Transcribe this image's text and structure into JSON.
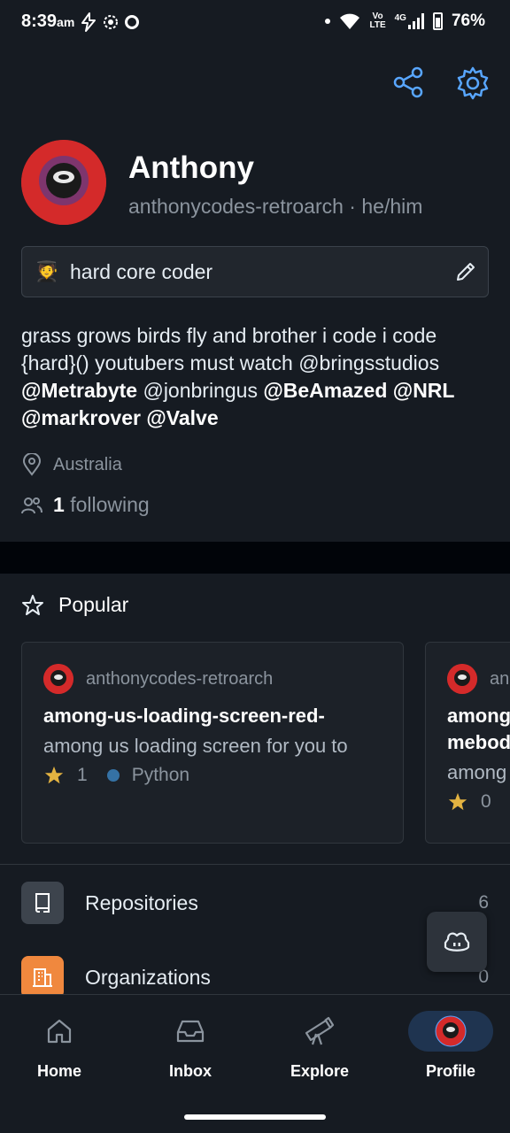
{
  "status_bar": {
    "time": "8:39",
    "ampm": "am",
    "network_top": "Vo",
    "network_bottom": "LTE",
    "network_type": "4G",
    "battery": "76%"
  },
  "profile": {
    "name": "Anthony",
    "login_line": "anthonycodes-retroarch · he/him",
    "status_emoji": "🧑‍🎓",
    "status_text": "hard core coder",
    "bio_parts": {
      "p1": "grass grows birds fly and brother i code i code {hard}() youtubers must watch @bringsstudios ",
      "m1": "@Metrabyte",
      "p2": " @jonbringus ",
      "m2": "@BeAmazed",
      "p3": " ",
      "m3": "@NRL",
      "p4": " ",
      "m4": "@markrover",
      "p5": " ",
      "m5": "@Valve"
    },
    "location": "Australia",
    "following_count": "1",
    "following_label": "following"
  },
  "popular": {
    "title": "Popular",
    "cards": [
      {
        "owner": "anthonycodes-retroarch",
        "name": "among-us-loading-screen-red-",
        "description": "among us loading screen for you to",
        "stars": "1",
        "language": "Python"
      },
      {
        "owner": "an",
        "name_line1": "among",
        "name_line2": "mebod",
        "description": "among",
        "stars": "0"
      }
    ]
  },
  "lists": [
    {
      "label": "Repositories",
      "count": "6",
      "color": "#3d444d"
    },
    {
      "label": "Organizations",
      "count": "0",
      "color": "#f0883e"
    }
  ],
  "nav": {
    "home": "Home",
    "inbox": "Inbox",
    "explore": "Explore",
    "profile": "Profile"
  },
  "colors": {
    "background": "#161b22",
    "accent": "#58a6ff",
    "avatar": "#d42a2a",
    "python": "#3572a5",
    "star": "#e3b341"
  }
}
